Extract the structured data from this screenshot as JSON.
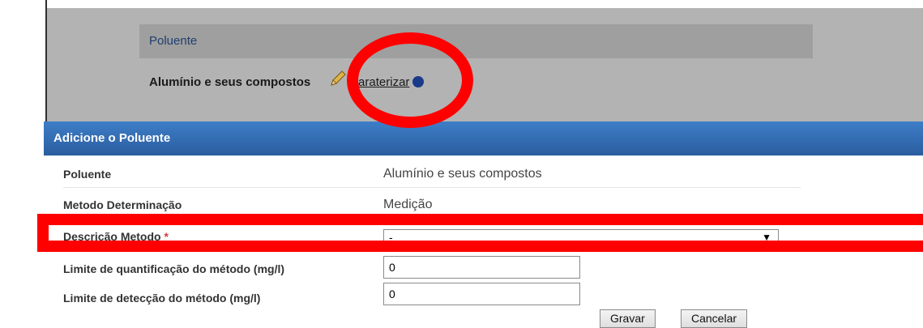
{
  "background": {
    "section_header": "Poluente",
    "pollutant_name": "Alumínio e seus compostos",
    "characterize_link": "Caraterizar",
    "icons": [
      "pencil-icon",
      "info-icon"
    ]
  },
  "dialog": {
    "title": "Adicione o Poluente",
    "rows": [
      {
        "label": "Poluente",
        "value": "Alumínio e seus compostos"
      },
      {
        "label": "Metodo Determinação",
        "value": "Medição"
      }
    ],
    "method_description": {
      "label": "Descrição Metodo",
      "required_mark": "*",
      "selected": "-",
      "arrow": "▼"
    },
    "quant_limit": {
      "label": "Limite de quantificação do método (mg/l)",
      "value": "0"
    },
    "detect_limit": {
      "label": "Limite de detecção do método (mg/l)",
      "value": "0"
    },
    "buttons": {
      "save": "Gravar",
      "cancel": "Cancelar"
    }
  },
  "colors": {
    "annotation": "#ff0000",
    "titlebar": "#2f67ae"
  }
}
